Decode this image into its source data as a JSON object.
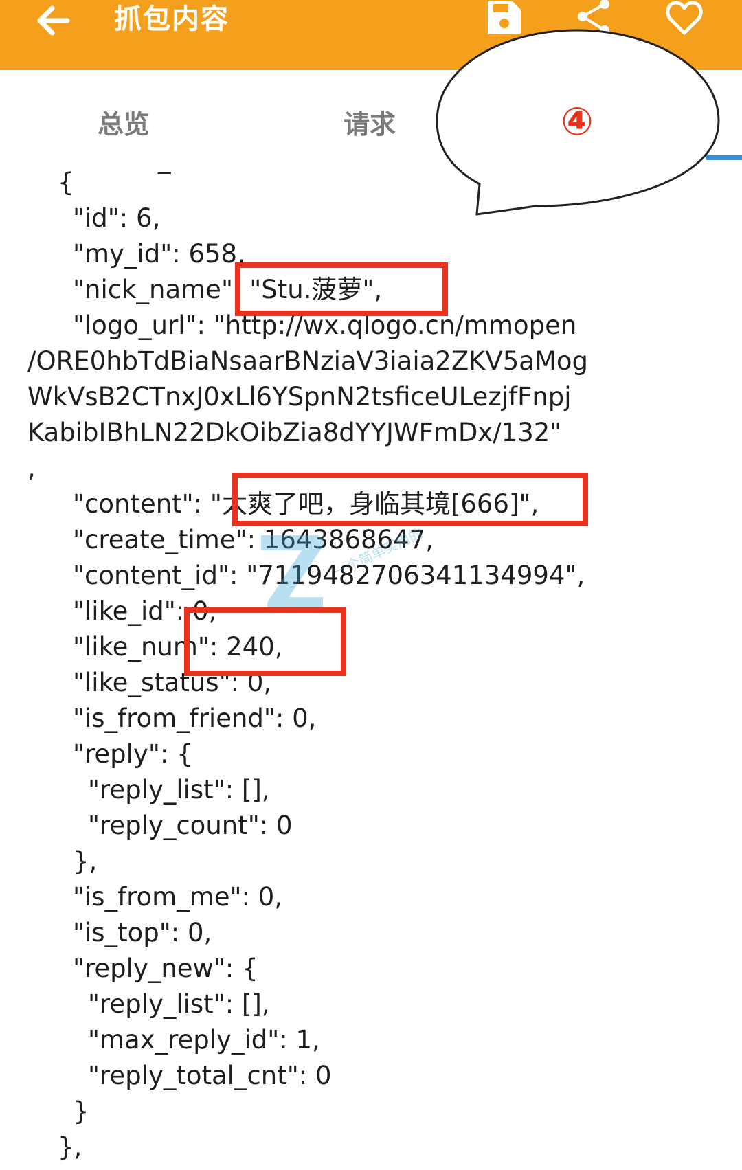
{
  "app_bar": {
    "title": "抓包内容",
    "icons": [
      "back-arrow-icon",
      "save-icon",
      "share-icon",
      "heart-icon"
    ],
    "color": "#F5A01C"
  },
  "tabs": [
    "总览",
    "请求"
  ],
  "annotation": {
    "label": "④"
  },
  "code_lines": [
    "_",
    "{",
    "\"id\": 6,",
    "\"my_id\": 658,",
    "\"nick_name\": \"Stu.菠萝\",",
    "\"logo_url\": \"http://wx.qlogo.cn/mmopen",
    "/ORE0hbTdBiaNsaarBNziaV3iaia2ZKV5aMog",
    "WkVsB2CTnxJ0xLl6YSpnN2tsficeULezjfFnpj",
    "KabibIBhLN22DkOibZia8dYYJWFmDx/132\"",
    ",",
    "\"content\": \"太爽了吧，身临其境[666]\",",
    "\"create_time\": 1643868647,",
    "\"content_id\": \"7119482706341134994\",",
    "\"like_id\": 0,",
    "\"like_num\": 240,",
    "\"like_status\": 0,",
    "\"is_from_friend\": 0,",
    "\"reply\": {",
    "\"reply_list\": [],",
    "\"reply_count\": 0",
    "},",
    "\"is_from_me\": 0,",
    "\"is_top\": 0,",
    "\"reply_new\": {",
    "\"reply_list\": [],",
    "\"max_reply_id\": 1,",
    "\"reply_total_cnt\": 0",
    "}",
    "},"
  ],
  "watermark": {
    "text": "一个简单实用的"
  },
  "colors": {
    "highlight": "#E8321E",
    "annotation_text": "#E8321E",
    "tab_indicator": "#3d8fd1"
  }
}
